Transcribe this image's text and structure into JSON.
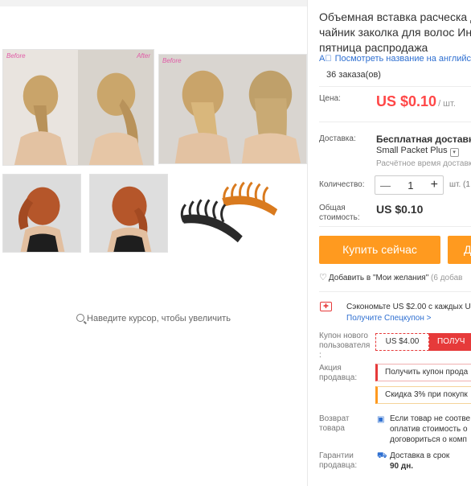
{
  "gallery": {
    "before_label": "Before",
    "after_label": "After",
    "zoom_hint": "Наведите курсор, чтобы увеличить",
    "magnifier_icon": "search-icon",
    "colors": {
      "hair_blonde": "#c9a46a",
      "hair_red": "#b5562a",
      "comb_black": "#2a2a2a",
      "comb_orange": "#d97a1e"
    }
  },
  "product": {
    "title": "Объемная вставка расческа для\nчайник заколка для волос Инстр\nпятница распродажа",
    "translate_link": "Посмотреть название на английс",
    "translate_icon": "translate-icon",
    "orders": "36 заказа(ов)"
  },
  "price": {
    "label": "Цена:",
    "value": "US $0.10",
    "unit": "/ шт.",
    "color": "#ff4747"
  },
  "shipping": {
    "label": "Доставка:",
    "main": "Бесплатная доставка в",
    "method": "Small Packet Plus",
    "time": "Расчётное время доставк"
  },
  "quantity": {
    "label": "Количество:",
    "value": "1",
    "minus": "—",
    "plus": "+",
    "suffix": "шт. (1"
  },
  "total": {
    "label": "Общая\nстоимость:",
    "value": "US $0.10"
  },
  "actions": {
    "buy_now": "Купить сейчас",
    "add_to_cart": "Д",
    "wishlist": "Добавить в \"Мои желания\"",
    "wishlist_count": "(6 добав",
    "accent": "#ff9a1f"
  },
  "coupons": {
    "save_line": "Сэкономьте US $2.00 с каждых U",
    "get_link": "Получите Спецкупон >",
    "new_user_label": "Купон нового\nпользователя\n:",
    "new_user_value": "US $4.00",
    "new_user_get": "ПОЛУЧ"
  },
  "promo": {
    "label": "Акция\nпродавца:",
    "coupon_text": "Получить купон прода",
    "discount_text": "Скидка 3% при покупк"
  },
  "returns": {
    "label": "Возврат\nтовара",
    "text": "Если товар не соотве\nоплатив стоимость о\nдоговориться о комп"
  },
  "guarantee": {
    "label": "Гарантии\nпродавца:",
    "text": "Доставка в срок",
    "days": "90 дн."
  }
}
